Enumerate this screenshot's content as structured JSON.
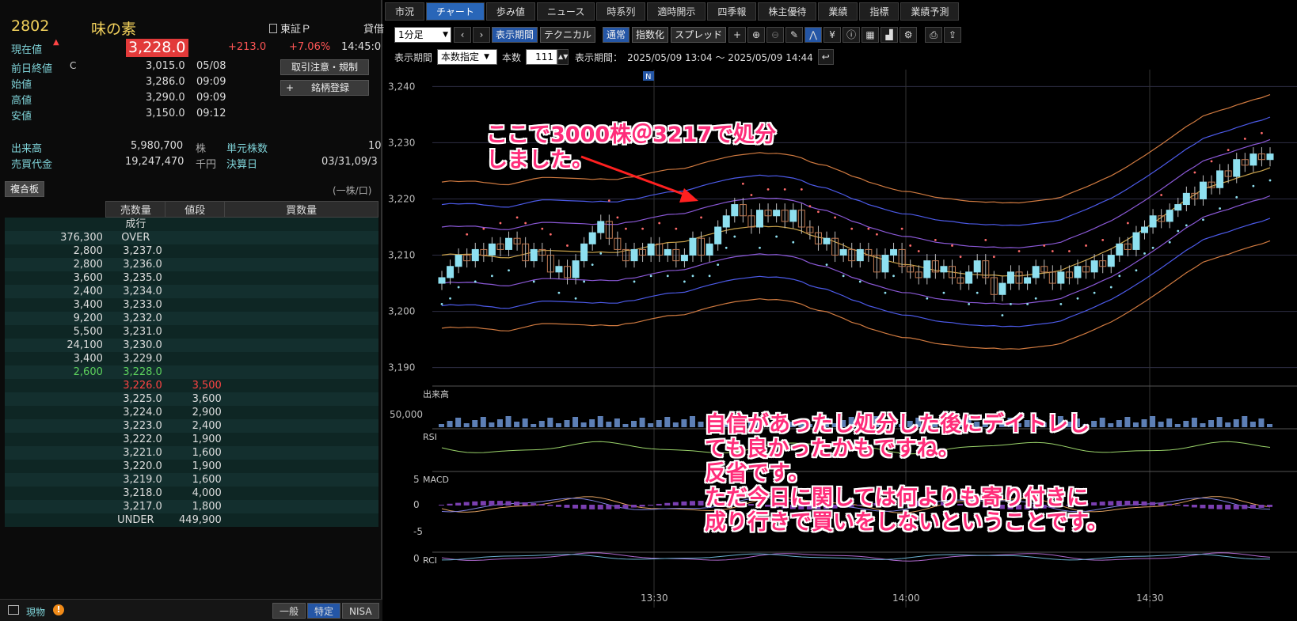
{
  "stock": {
    "code": "2802",
    "name": "味の素",
    "market": "東証Ｐ",
    "market_cut": "貸借",
    "current_label": "現在値",
    "current_price": "3,228.0",
    "change": "+213.0",
    "change_pct": "+7.06%",
    "time": "14:45:0",
    "rows": [
      {
        "label": "前日終値",
        "flag": "C",
        "value": "3,015.0",
        "time": "05/08"
      },
      {
        "label": "始値",
        "flag": "",
        "value": "3,286.0",
        "time": "09:09"
      },
      {
        "label": "高値",
        "flag": "",
        "value": "3,290.0",
        "time": "09:09"
      },
      {
        "label": "安値",
        "flag": "",
        "value": "3,150.0",
        "time": "09:12"
      }
    ],
    "volume_label": "出来高",
    "volume": "5,980,700",
    "volume_unit": "株",
    "amount_label": "売買代金",
    "amount": "19,247,470",
    "amount_unit": "千円",
    "unit_label": "単元株数",
    "unit_value": "10",
    "settle_label": "決算日",
    "settle_value": "03/31,09/3"
  },
  "buttons": {
    "notice": "取引注意・規制",
    "register": "銘柄登録",
    "board_tab": "複合板",
    "board_unit": "(一株/口)"
  },
  "board": {
    "headers": [
      "売数量",
      "値段",
      "買数量"
    ],
    "rows": [
      {
        "sell": "",
        "price": "成行",
        "buy": "",
        "cls": ""
      },
      {
        "sell": "376,300",
        "price": "OVER",
        "buy": "",
        "cls": ""
      },
      {
        "sell": "2,800",
        "price": "3,237.0",
        "buy": "",
        "cls": ""
      },
      {
        "sell": "2,800",
        "price": "3,236.0",
        "buy": "",
        "cls": ""
      },
      {
        "sell": "3,600",
        "price": "3,235.0",
        "buy": "",
        "cls": ""
      },
      {
        "sell": "2,400",
        "price": "3,234.0",
        "buy": "",
        "cls": ""
      },
      {
        "sell": "3,400",
        "price": "3,233.0",
        "buy": "",
        "cls": ""
      },
      {
        "sell": "9,200",
        "price": "3,232.0",
        "buy": "",
        "cls": ""
      },
      {
        "sell": "5,500",
        "price": "3,231.0",
        "buy": "",
        "cls": ""
      },
      {
        "sell": "24,100",
        "price": "3,230.0",
        "buy": "",
        "cls": ""
      },
      {
        "sell": "3,400",
        "price": "3,229.0",
        "buy": "",
        "cls": ""
      },
      {
        "sell": "2,600",
        "price": "3,228.0",
        "buy": "",
        "cls": "green"
      },
      {
        "sell": "",
        "price": "3,226.0",
        "buy": "3,500",
        "cls": "red"
      },
      {
        "sell": "",
        "price": "3,225.0",
        "buy": "3,600",
        "cls": ""
      },
      {
        "sell": "",
        "price": "3,224.0",
        "buy": "2,900",
        "cls": ""
      },
      {
        "sell": "",
        "price": "3,223.0",
        "buy": "2,400",
        "cls": ""
      },
      {
        "sell": "",
        "price": "3,222.0",
        "buy": "1,900",
        "cls": ""
      },
      {
        "sell": "",
        "price": "3,221.0",
        "buy": "1,600",
        "cls": ""
      },
      {
        "sell": "",
        "price": "3,220.0",
        "buy": "1,900",
        "cls": ""
      },
      {
        "sell": "",
        "price": "3,219.0",
        "buy": "1,600",
        "cls": ""
      },
      {
        "sell": "",
        "price": "3,218.0",
        "buy": "4,000",
        "cls": ""
      },
      {
        "sell": "",
        "price": "3,217.0",
        "buy": "1,800",
        "cls": ""
      },
      {
        "sell": "",
        "price": "UNDER",
        "buy": "449,900",
        "cls": ""
      }
    ]
  },
  "footer": {
    "genbutsu": "現物",
    "account_tabs": [
      "一般",
      "特定",
      "NISA"
    ]
  },
  "tabs": [
    "市況",
    "チャート",
    "歩み値",
    "ニュース",
    "時系列",
    "適時開示",
    "四季報",
    "株主優待",
    "業績",
    "指標",
    "業績予測"
  ],
  "toolbar": {
    "interval": "1分足",
    "period_button": "表示期間",
    "technical": "テクニカル",
    "normal": "通常",
    "index": "指数化",
    "spread": "スプレッド",
    "period_label": "表示期間",
    "period_mode": "本数指定",
    "bars_label": "本数",
    "bars": "111",
    "range_label": "表示期間：",
    "range": "2025/05/09 13:04 〜 2025/05/09 14:44"
  },
  "chart_data": {
    "type": "candlestick",
    "price_ticks": [
      3240,
      3230,
      3220,
      3210,
      3200,
      3190
    ],
    "price_tick_labels": [
      "3,240",
      "3,230",
      "3,220",
      "3,210",
      "3,200",
      "3,190"
    ],
    "ylim": [
      3187,
      3243
    ],
    "x_ticks": [
      "13:30",
      "14:00",
      "14:30"
    ],
    "marker": "N",
    "volume_label": "出来高",
    "volume_tick": "50,000",
    "rsi_label": "RSI",
    "macd_label": "MACD",
    "macd_ticks": [
      "5",
      "0",
      "-5"
    ],
    "rci_label": "RCI",
    "rci_tick": "0",
    "closes": [
      3206,
      3208,
      3210,
      3209,
      3211,
      3210,
      3212,
      3211,
      3213,
      3212,
      3209,
      3211,
      3210,
      3207,
      3208,
      3206,
      3209,
      3212,
      3214,
      3216,
      3213,
      3211,
      3209,
      3211,
      3210,
      3212,
      3210,
      3211,
      3209,
      3210,
      3213,
      3210,
      3212,
      3215,
      3217,
      3219,
      3217,
      3215,
      3218,
      3217,
      3218,
      3216,
      3218,
      3215,
      3214,
      3212,
      3213,
      3210,
      3211,
      3209,
      3211,
      3210,
      3207,
      3210,
      3211,
      3208,
      3207,
      3206,
      3209,
      3207,
      3208,
      3206,
      3205,
      3207,
      3209,
      3206,
      3203,
      3205,
      3207,
      3205,
      3206,
      3208,
      3207,
      3205,
      3207,
      3206,
      3208,
      3207,
      3209,
      3208,
      3210,
      3212,
      3211,
      3214,
      3215,
      3217,
      3216,
      3218,
      3219,
      3221,
      3220,
      3223,
      3222,
      3225,
      3224,
      3227,
      3226,
      3228,
      3227,
      3228
    ]
  },
  "annotations": {
    "top": "ここで3000株＠3217で処分\nしました。",
    "bottom": "自信があったし処分した後にデイトレし\nても良かったかもですね。\n反省です。\nただ今日に関しては何よりも寄り付きに\n成り行きで買いをしないということです。"
  },
  "colors": {
    "up_candle": "#8ee0f0",
    "down_candle": "#c07a52",
    "sar": "#ff6b6b",
    "annotation": "#ff2d7a"
  }
}
